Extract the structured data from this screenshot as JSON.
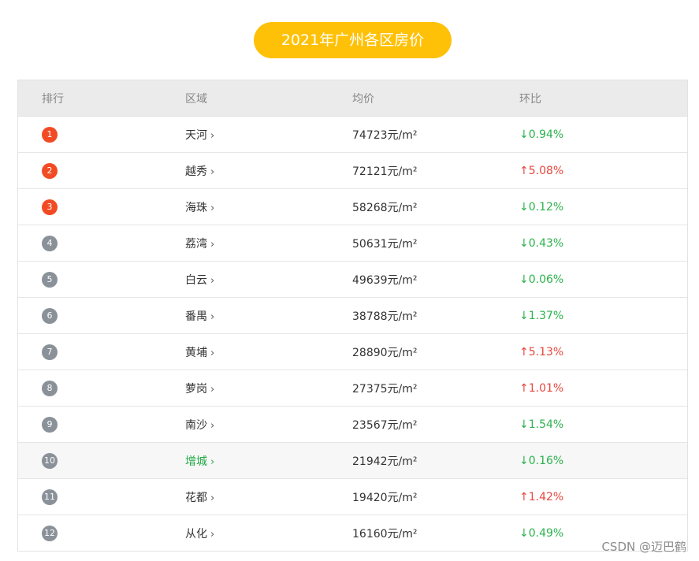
{
  "title": "2021年广州各区房价",
  "columns": [
    "排行",
    "区域",
    "均价",
    "环比"
  ],
  "rows": [
    {
      "rank": "1",
      "region": "天河",
      "price": "74723元/m²",
      "change": "↓0.94%",
      "direction": "down"
    },
    {
      "rank": "2",
      "region": "越秀",
      "price": "72121元/m²",
      "change": "↑5.08%",
      "direction": "up"
    },
    {
      "rank": "3",
      "region": "海珠",
      "price": "58268元/m²",
      "change": "↓0.12%",
      "direction": "down"
    },
    {
      "rank": "4",
      "region": "荔湾",
      "price": "50631元/m²",
      "change": "↓0.43%",
      "direction": "down"
    },
    {
      "rank": "5",
      "region": "白云",
      "price": "49639元/m²",
      "change": "↓0.06%",
      "direction": "down"
    },
    {
      "rank": "6",
      "region": "番禺",
      "price": "38788元/m²",
      "change": "↓1.37%",
      "direction": "down"
    },
    {
      "rank": "7",
      "region": "黄埔",
      "price": "28890元/m²",
      "change": "↑5.13%",
      "direction": "up"
    },
    {
      "rank": "8",
      "region": "萝岗",
      "price": "27375元/m²",
      "change": "↑1.01%",
      "direction": "up"
    },
    {
      "rank": "9",
      "region": "南沙",
      "price": "23567元/m²",
      "change": "↓1.54%",
      "direction": "down"
    },
    {
      "rank": "10",
      "region": "增城",
      "price": "21942元/m²",
      "change": "↓0.16%",
      "direction": "down"
    },
    {
      "rank": "11",
      "region": "花都",
      "price": "19420元/m²",
      "change": "↑1.42%",
      "direction": "up"
    },
    {
      "rank": "12",
      "region": "从化",
      "price": "16160元/m²",
      "change": "↓0.49%",
      "direction": "down"
    }
  ],
  "chevron": "›",
  "watermark": "CSDN @迈巴鹤",
  "colors": {
    "title_bg": "#ffc107",
    "top_badge": "#f24b24",
    "badge": "#8a9199",
    "up": "#e8453c",
    "down": "#2bb24c",
    "highlight_region": "#22aa44"
  }
}
